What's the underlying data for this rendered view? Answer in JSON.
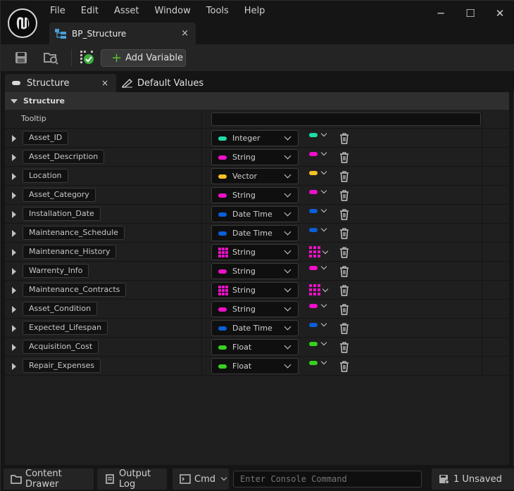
{
  "menu": [
    "File",
    "Edit",
    "Asset",
    "Window",
    "Tools",
    "Help"
  ],
  "window_controls": {
    "minimize": "─",
    "maximize": "☐",
    "close": "✕"
  },
  "document_tab": {
    "label": "BP_Structure",
    "close": "×"
  },
  "toolbar": {
    "add_variable_label": "Add Variable"
  },
  "panel_tabs": {
    "structure": "Structure",
    "structure_close": "×",
    "default_values": "Default Values"
  },
  "section": {
    "title": "Structure"
  },
  "tooltip": {
    "label": "Tooltip",
    "value": ""
  },
  "colors": {
    "integer": "#1fdca8",
    "string": "#ee10c8",
    "vector": "#f6c024",
    "datetime": "#0a5fd8",
    "float": "#38d020"
  },
  "variables": [
    {
      "name": "Asset_ID",
      "type": "Integer",
      "color": "#1fdca8",
      "container": "single"
    },
    {
      "name": "Asset_Description",
      "type": "String",
      "color": "#ee10c8",
      "container": "single"
    },
    {
      "name": "Location",
      "type": "Vector",
      "color": "#f6c024",
      "container": "single"
    },
    {
      "name": "Asset_Category",
      "type": "String",
      "color": "#ee10c8",
      "container": "single"
    },
    {
      "name": "Installation_Date",
      "type": "Date Time",
      "color": "#0a5fd8",
      "container": "single"
    },
    {
      "name": "Maintenance_Schedule",
      "type": "Date Time",
      "color": "#0a5fd8",
      "container": "single"
    },
    {
      "name": "Maintenance_History",
      "type": "String",
      "color": "#ee10c8",
      "container": "array"
    },
    {
      "name": "Warrenty_Info",
      "type": "String",
      "color": "#ee10c8",
      "container": "single"
    },
    {
      "name": "Maintenance_Contracts",
      "type": "String",
      "color": "#ee10c8",
      "container": "array"
    },
    {
      "name": "Asset_Condition",
      "type": "String",
      "color": "#ee10c8",
      "container": "single"
    },
    {
      "name": "Expected_Lifespan",
      "type": "Date Time",
      "color": "#0a5fd8",
      "container": "single"
    },
    {
      "name": "Acquisition_Cost",
      "type": "Float",
      "color": "#38d020",
      "container": "single"
    },
    {
      "name": "Repair_Expenses",
      "type": "Float",
      "color": "#38d020",
      "container": "single"
    }
  ],
  "statusbar": {
    "content_drawer": "Content Drawer",
    "output_log": "Output Log",
    "cmd": "Cmd",
    "console_placeholder": "Enter Console Command",
    "unsaved": "1 Unsaved"
  }
}
